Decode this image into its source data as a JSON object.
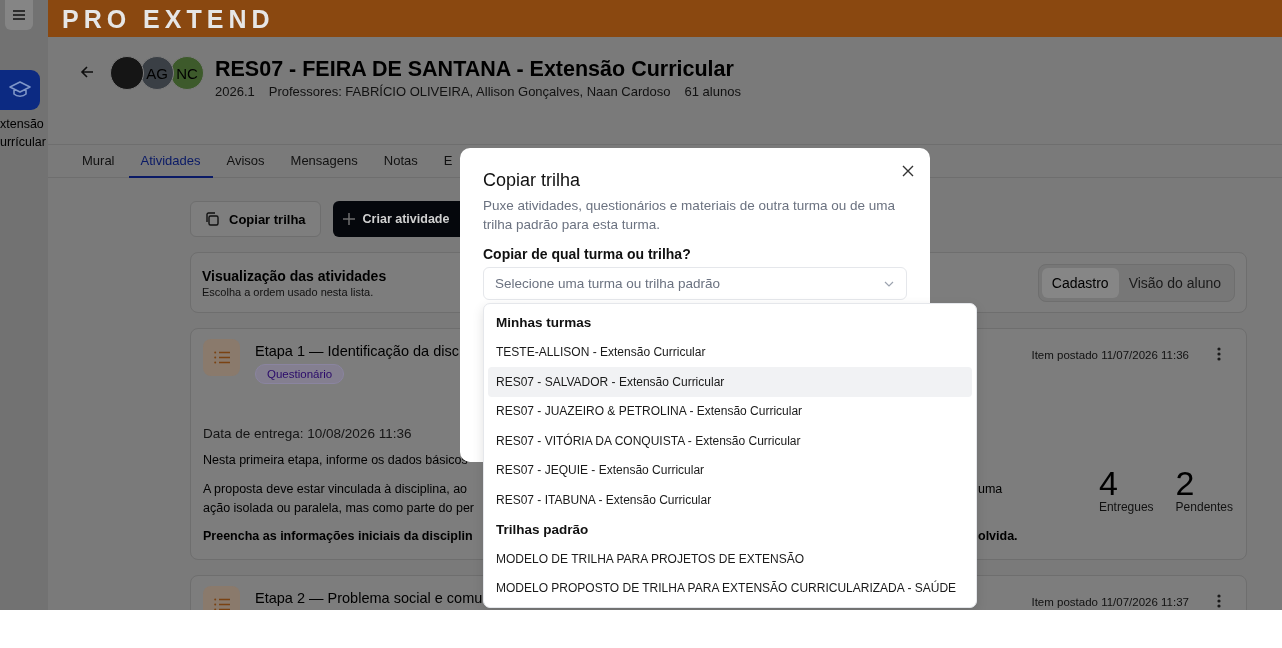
{
  "top_bar": {
    "logo": "PRO EXTEND"
  },
  "sidebar": {
    "items": [
      {
        "label": "xtensão urrícular",
        "selected": true
      }
    ]
  },
  "course": {
    "avatars": [
      {
        "kind": "photo"
      },
      {
        "kind": "initials",
        "initials": "AG",
        "color": "#3a3f45"
      },
      {
        "kind": "initials",
        "initials": "NC",
        "color": "#3d5a2b"
      }
    ],
    "title": "RES07 - FEIRA DE SANTANA - Extensão Curricular",
    "term": "2026.1",
    "teachers": "Professores: FABRÍCIO OLIVEIRA, Allison Gonçalves, Naan Cardoso",
    "students": "61 alunos"
  },
  "tabs": [
    {
      "label": "Mural",
      "selected": false
    },
    {
      "label": "Atividades",
      "selected": true
    },
    {
      "label": "Avisos",
      "selected": false
    },
    {
      "label": "Mensagens",
      "selected": false
    },
    {
      "label": "Notas",
      "selected": false
    },
    {
      "label": "E",
      "selected": false
    }
  ],
  "actions": [
    {
      "kind": "outline",
      "label": "Copiar trilha"
    },
    {
      "kind": "primary",
      "label": "Criar atividade"
    }
  ],
  "view_panel": {
    "title": "Visualização das atividades",
    "subtitle": "Escolha a ordem usado nesta lista.",
    "options": [
      {
        "label": "Cadastro",
        "selected": true
      },
      {
        "label": "Visão do aluno",
        "selected": false
      }
    ]
  },
  "activities": [
    {
      "title": "Etapa 1 — Identificação da disc",
      "type": "Questionário",
      "posted": "Item postado 11/07/2026 11:36",
      "due": "Data de entrega: 10/08/2026 11:36",
      "lines": [
        {
          "kind": "normal",
          "left": "Nesta primeira etapa, informe os dados básicos"
        },
        {
          "kind": "normal",
          "left": "A proposta deve estar vinculada à disciplina, ao",
          "right": "uma"
        },
        {
          "kind": "tight",
          "left": "ação isolada ou paralela, mas como parte do per"
        },
        {
          "kind": "bold",
          "left": "Preencha as informações iniciais da disciplin",
          "right": "olvida."
        }
      ],
      "stats": [
        {
          "value": "4",
          "label": "Entregues"
        },
        {
          "value": "2",
          "label": "Pendentes"
        }
      ]
    },
    {
      "title": "Etapa 2 — Problema social e comu",
      "posted": "Item postado 11/07/2026 11:37"
    }
  ],
  "dialog": {
    "title": "Copiar trilha",
    "description": "Puxe atividades, questionários e materiais de outra turma ou de uma trilha padrão para esta turma.",
    "field_label": "Copiar de qual turma ou trilha?",
    "select": {
      "placeholder": "Selecione uma turma ou trilha padrão"
    },
    "dropdown": {
      "groups": [
        {
          "heading": "Minhas turmas",
          "items": [
            {
              "label": "TESTE-ALLISON - Extensão Curricular",
              "selected": false
            },
            {
              "label": "RES07 - SALVADOR - Extensão Curricular",
              "selected": true
            },
            {
              "label": "RES07 - JUAZEIRO & PETROLINA - Extensão Curricular",
              "selected": false
            },
            {
              "label": "RES07 - VITÓRIA DA CONQUISTA - Extensão Curricular",
              "selected": false
            },
            {
              "label": "RES07 - JEQUIE - Extensão Curricular",
              "selected": false
            },
            {
              "label": "RES07 - ITABUNA - Extensão Curricular",
              "selected": false
            }
          ]
        },
        {
          "heading": "Trilhas padrão",
          "items": [
            {
              "label": "MODELO DE TRILHA PARA PROJETOS DE EXTENSÃO",
              "selected": false
            },
            {
              "label": "MODELO PROPOSTO DE TRILHA PARA EXTENSÃO CURRICULARIZADA - SAÚDE",
              "selected": false
            }
          ]
        }
      ]
    }
  }
}
